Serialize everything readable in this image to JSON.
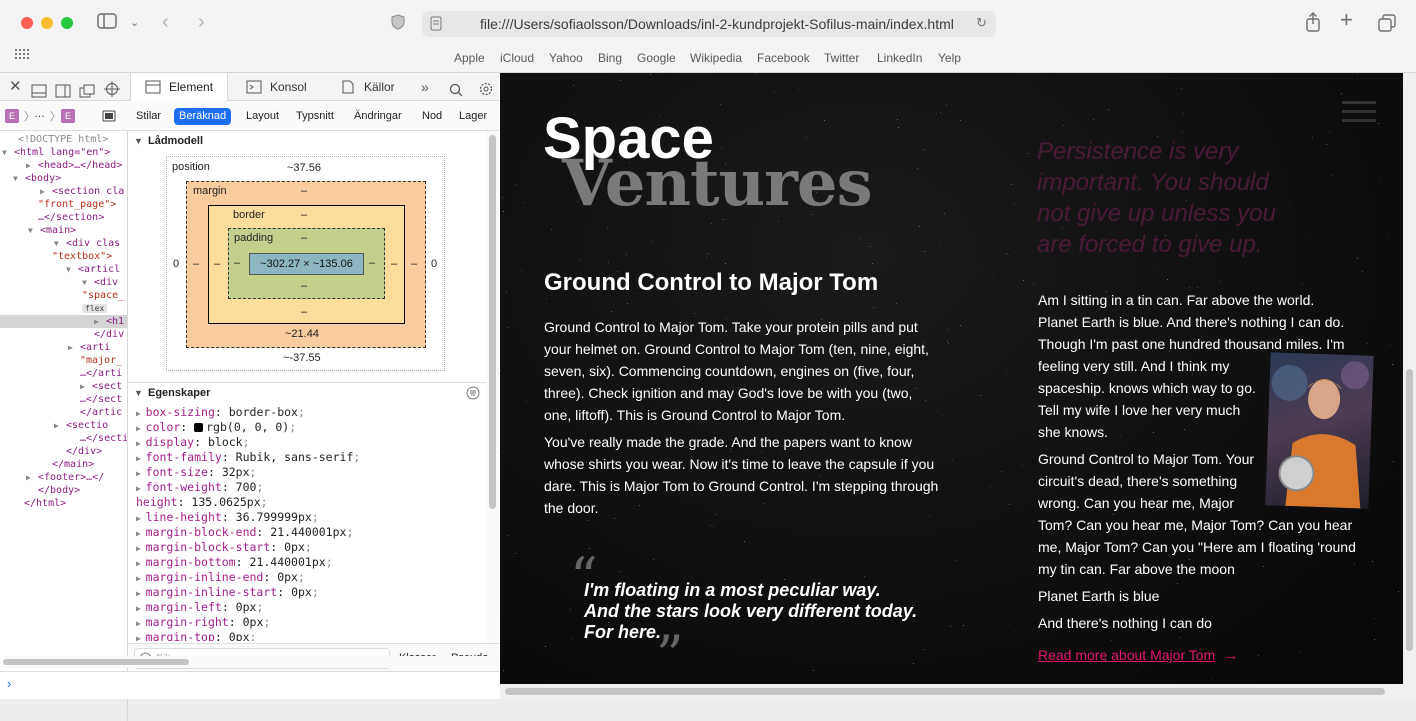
{
  "browser": {
    "url": "file:///Users/sofiaolsson/Downloads/inl-2-kundprojekt-Sofilus-main/index.html",
    "favorites": [
      "Apple",
      "iCloud",
      "Yahoo",
      "Bing",
      "Google",
      "Wikipedia",
      "Facebook",
      "Twitter",
      "LinkedIn",
      "Yelp"
    ]
  },
  "devtools": {
    "tabs": [
      "Element",
      "Konsol",
      "Källor"
    ],
    "subtabs": [
      "Stilar",
      "Beräknad",
      "Layout",
      "Typsnitt",
      "Ändringar",
      "Nod",
      "Lager"
    ],
    "breadcrumb_letter": "E",
    "breadcrumb_dots": "…",
    "dom_lines": [
      "<!DOCTYPE html>",
      "<html lang=\"en\">",
      "<head>…</head>",
      "<body>",
      "<section cla",
      "\"front_page\">",
      "…</section>",
      "<main>",
      "<div clas",
      "\"textbox\">",
      "<articl",
      "<div",
      "\"space_",
      "flex",
      "<h1",
      "</div",
      "<arti",
      "\"major_",
      "…</arti",
      "<sect",
      "…</sect",
      "</artic",
      "<sectio",
      "…</sectio",
      "</div>",
      "</main>",
      "<footer>…</",
      "</body>",
      "</html>"
    ],
    "boxmodel": {
      "title": "Lådmodell",
      "position_label": "position",
      "position_top": "~37.56",
      "position_bottom": "~-37.55",
      "position_left": "0",
      "position_right": "0",
      "margin_label": "margin",
      "margin_top": "–",
      "margin_bottom": "~21.44",
      "margin_left": "–",
      "margin_right": "–",
      "border_label": "border",
      "border_top": "–",
      "border_bottom": "–",
      "border_left": "–",
      "border_right": "–",
      "padding_label": "padding",
      "padding_top": "–",
      "padding_bottom": "–",
      "padding_left": "–",
      "padding_right": "–",
      "content": "~302.27 × ~135.06"
    },
    "properties_title": "Egenskaper",
    "properties": [
      {
        "k": "box-sizing",
        "v": "border-box"
      },
      {
        "k": "color",
        "v": "rgb(0, 0, 0)"
      },
      {
        "k": "display",
        "v": "block"
      },
      {
        "k": "font-family",
        "v": "Rubik, sans-serif"
      },
      {
        "k": "font-size",
        "v": "32px"
      },
      {
        "k": "font-weight",
        "v": "700"
      },
      {
        "k": "height",
        "v": "135.0625px"
      },
      {
        "k": "line-height",
        "v": "36.799999px"
      },
      {
        "k": "margin-block-end",
        "v": "21.440001px"
      },
      {
        "k": "margin-block-start",
        "v": "0px"
      },
      {
        "k": "margin-bottom",
        "v": "21.440001px"
      },
      {
        "k": "margin-inline-end",
        "v": "0px"
      },
      {
        "k": "margin-inline-start",
        "v": "0px"
      },
      {
        "k": "margin-left",
        "v": "0px"
      },
      {
        "k": "margin-right",
        "v": "0px"
      },
      {
        "k": "margin-top",
        "v": "0px"
      }
    ],
    "filter_placeholder": "Filter",
    "classes_label": "Klasser",
    "pseudo_label": "Pseudo"
  },
  "page": {
    "logo_top": "Space",
    "logo_bottom": "Ventures",
    "heading": "Ground Control to Major Tom",
    "para1": "Ground Control to Major Tom. Take your protein pills and put your helmet on. Ground Control to Major Tom (ten, nine, eight, seven, six). Commencing countdown, engines on (five, four, three). Check ignition and may God's love be with you (two, one, liftoff). This is Ground Control to Major Tom.",
    "para2": "You've really made the grade. And the papers want to know whose shirts you wear. Now it's time to leave the capsule if you dare. This is Major Tom to Ground Control. I'm stepping through the door.",
    "quote_l1": "I'm floating in a most peculiar way.",
    "quote_l2": "And the stars look very different today.",
    "quote_l3": "For here.",
    "side_quote_1": "Persistence is very",
    "side_quote_2": "important. You should",
    "side_quote_3": "not give up unless you",
    "side_quote_4": "are forced to give up.",
    "right_p1_lines": [
      "Am I sitting in a tin can. Far above the world.",
      "Planet Earth is blue. And there's nothing I can do.",
      "Though I'm past one hundred thousand miles. I'm",
      "feeling very still. And I think my",
      "spaceship. knows which way to go.",
      "Tell my wife I love her very much",
      "she knows."
    ],
    "right_p2_lines": [
      "Ground Control to Major Tom. Your",
      "circuit's dead, there's something",
      "wrong. Can you hear me, Major",
      "Tom? Can you hear me, Major Tom? Can you hear",
      "me, Major Tom? Can you \"Here am I floating 'round",
      "my tin can. Far above the moon"
    ],
    "right_p3": "Planet Earth is blue",
    "right_p4": "And there's nothing I can do",
    "read_more": "Read more about Major Tom",
    "accent": "#e0156e"
  }
}
